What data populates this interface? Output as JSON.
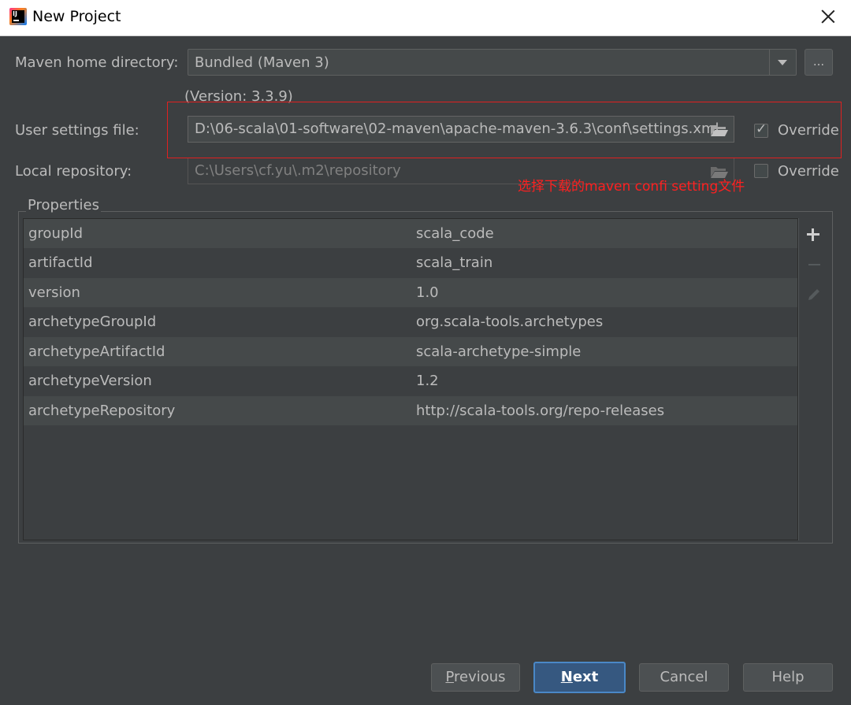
{
  "window": {
    "title": "New Project",
    "app_icon_text": "IJ"
  },
  "maven_home": {
    "label": "Maven home directory:",
    "value": "Bundled (Maven 3)",
    "browse_label": "...",
    "version_text": "(Version: 3.3.9)"
  },
  "user_settings": {
    "label": "User settings file:",
    "value": "D:\\06-scala\\01-software\\02-maven\\apache-maven-3.6.3\\conf\\settings.xml",
    "override_label": "Override",
    "override_checked": true
  },
  "local_repo": {
    "label": "Local repository:",
    "value": "C:\\Users\\cf.yu\\.m2\\repository",
    "override_label": "Override",
    "override_checked": false
  },
  "annotation": {
    "text": "选择下载的maven confi setting文件",
    "color": "#ff2020"
  },
  "properties": {
    "title": "Properties",
    "rows": [
      {
        "key": "groupId",
        "value": "scala_code"
      },
      {
        "key": "artifactId",
        "value": "scala_train"
      },
      {
        "key": "version",
        "value": "1.0"
      },
      {
        "key": "archetypeGroupId",
        "value": "org.scala-tools.archetypes"
      },
      {
        "key": "archetypeArtifactId",
        "value": "scala-archetype-simple"
      },
      {
        "key": "archetypeVersion",
        "value": "1.2"
      },
      {
        "key": "archetypeRepository",
        "value": "http://scala-tools.org/repo-releases"
      }
    ],
    "tools": [
      "add-icon",
      "remove-icon",
      "edit-icon"
    ]
  },
  "footer": {
    "previous_mnemonic": "P",
    "previous_rest": "revious",
    "next_mnemonic": "N",
    "next_rest": "ext",
    "cancel": "Cancel",
    "help": "Help"
  },
  "colors": {
    "background": "#3c3f41",
    "accent": "#365880",
    "highlight": "#e02020"
  }
}
